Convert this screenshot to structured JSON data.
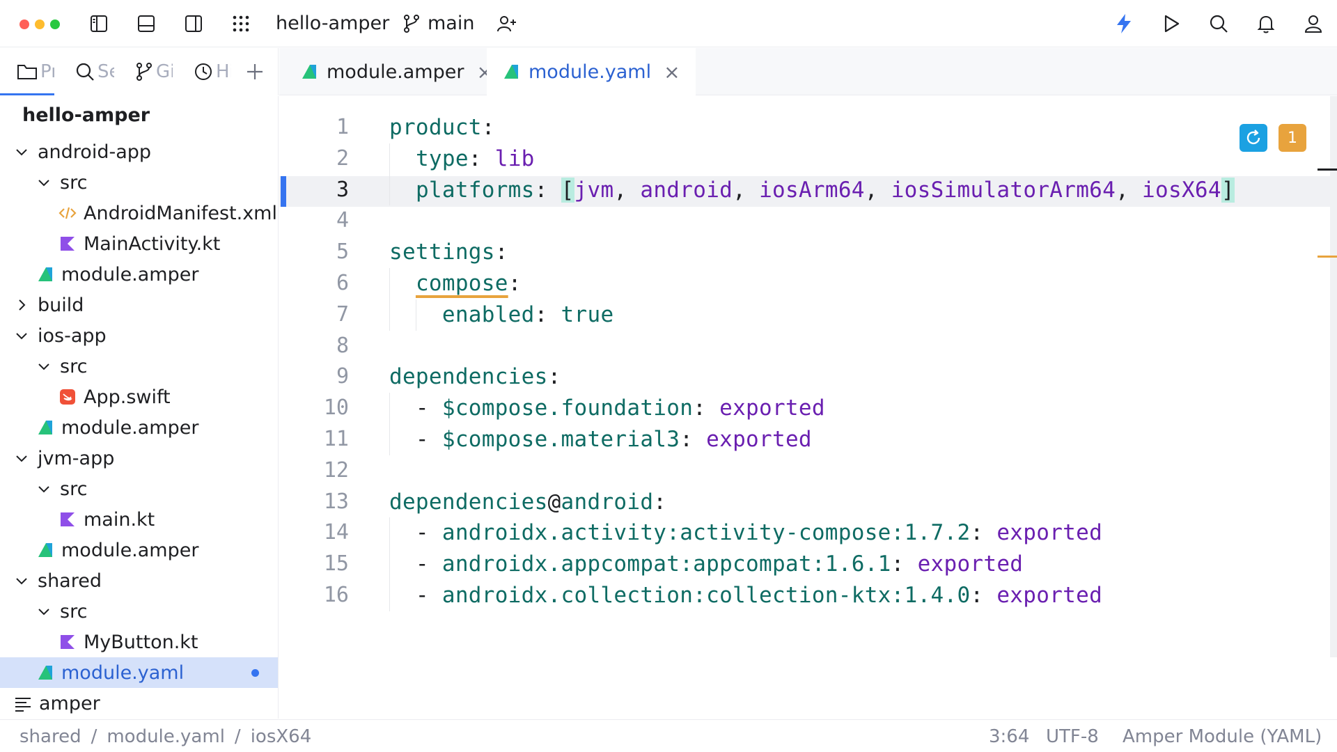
{
  "titlebar": {
    "project_name": "hello-amper",
    "branch": "main",
    "traffic_colors": [
      "#ff5f57",
      "#febc2e",
      "#28c840"
    ]
  },
  "tool_windows": [
    {
      "label": "Project",
      "icon": "folder-icon"
    },
    {
      "label": "Search",
      "icon": "search-icon"
    },
    {
      "label": "Git",
      "icon": "git-branch-icon"
    },
    {
      "label": "History",
      "icon": "clock-icon"
    }
  ],
  "tabs": [
    {
      "label": "module.amper",
      "active": false
    },
    {
      "label": "module.yaml",
      "active": true
    }
  ],
  "tree": {
    "root": "hello-amper",
    "items": [
      {
        "label": "android-app",
        "depth": 0,
        "type": "folder",
        "open": true
      },
      {
        "label": "src",
        "depth": 1,
        "type": "folder",
        "open": true
      },
      {
        "label": "AndroidManifest.xml",
        "depth": 2,
        "type": "xml"
      },
      {
        "label": "MainActivity.kt",
        "depth": 2,
        "type": "kotlin"
      },
      {
        "label": "module.amper",
        "depth": 1,
        "type": "amper"
      },
      {
        "label": "build",
        "depth": 0,
        "type": "folder",
        "open": false
      },
      {
        "label": "ios-app",
        "depth": 0,
        "type": "folder",
        "open": true
      },
      {
        "label": "src",
        "depth": 1,
        "type": "folder",
        "open": true
      },
      {
        "label": "App.swift",
        "depth": 2,
        "type": "swift"
      },
      {
        "label": "module.amper",
        "depth": 1,
        "type": "amper"
      },
      {
        "label": "jvm-app",
        "depth": 0,
        "type": "folder",
        "open": true
      },
      {
        "label": "src",
        "depth": 1,
        "type": "folder",
        "open": true
      },
      {
        "label": "main.kt",
        "depth": 2,
        "type": "kotlin"
      },
      {
        "label": "module.amper",
        "depth": 1,
        "type": "amper"
      },
      {
        "label": "shared",
        "depth": 0,
        "type": "folder",
        "open": true
      },
      {
        "label": "src",
        "depth": 1,
        "type": "folder",
        "open": true
      },
      {
        "label": "MyButton.kt",
        "depth": 2,
        "type": "kotlin"
      },
      {
        "label": "module.yaml",
        "depth": 1,
        "type": "amper",
        "selected": true,
        "modified": true
      },
      {
        "label": "amper",
        "depth": 0,
        "type": "text"
      }
    ]
  },
  "editor": {
    "current_line": 3,
    "lines": [
      [
        {
          "t": "product",
          "c": "k"
        },
        {
          "t": ":",
          "c": "p"
        }
      ],
      [
        {
          "t": "  "
        },
        {
          "t": "type",
          "c": "k"
        },
        {
          "t": ": ",
          "c": "p"
        },
        {
          "t": "lib",
          "c": "v"
        }
      ],
      [
        {
          "t": "  "
        },
        {
          "t": "platforms",
          "c": "k"
        },
        {
          "t": ": ",
          "c": "p"
        },
        {
          "t": "[",
          "c": "p br"
        },
        {
          "t": "jvm",
          "c": "v"
        },
        {
          "t": ", ",
          "c": "p"
        },
        {
          "t": "android",
          "c": "v"
        },
        {
          "t": ", ",
          "c": "p"
        },
        {
          "t": "iosArm64",
          "c": "v"
        },
        {
          "t": ", ",
          "c": "p"
        },
        {
          "t": "iosSimulatorArm64",
          "c": "v"
        },
        {
          "t": ", ",
          "c": "p"
        },
        {
          "t": "iosX64",
          "c": "v"
        },
        {
          "t": "]",
          "c": "p br"
        }
      ],
      [],
      [
        {
          "t": "settings",
          "c": "k"
        },
        {
          "t": ":",
          "c": "p"
        }
      ],
      [
        {
          "t": "  "
        },
        {
          "t": "compose",
          "c": "k warn-ul"
        },
        {
          "t": ":",
          "c": "p"
        }
      ],
      [
        {
          "t": "    "
        },
        {
          "t": "enabled",
          "c": "k"
        },
        {
          "t": ": ",
          "c": "p"
        },
        {
          "t": "true",
          "c": "k"
        }
      ],
      [],
      [
        {
          "t": "dependencies",
          "c": "k"
        },
        {
          "t": ":",
          "c": "p"
        }
      ],
      [
        {
          "t": "  - ",
          "c": "p"
        },
        {
          "t": "$compose.foundation",
          "c": "k"
        },
        {
          "t": ": ",
          "c": "p"
        },
        {
          "t": "exported",
          "c": "v"
        }
      ],
      [
        {
          "t": "  - ",
          "c": "p"
        },
        {
          "t": "$compose.material3",
          "c": "k"
        },
        {
          "t": ": ",
          "c": "p"
        },
        {
          "t": "exported",
          "c": "v"
        }
      ],
      [],
      [
        {
          "t": "dependencies",
          "c": "k"
        },
        {
          "t": "@",
          "c": "p"
        },
        {
          "t": "android",
          "c": "k"
        },
        {
          "t": ":",
          "c": "p"
        }
      ],
      [
        {
          "t": "  - ",
          "c": "p"
        },
        {
          "t": "androidx.activity:activity-compose:1.7.2",
          "c": "k"
        },
        {
          "t": ": ",
          "c": "p"
        },
        {
          "t": "exported",
          "c": "v"
        }
      ],
      [
        {
          "t": "  - ",
          "c": "p"
        },
        {
          "t": "androidx.appcompat:appcompat:1.6.1",
          "c": "k"
        },
        {
          "t": ": ",
          "c": "p"
        },
        {
          "t": "exported",
          "c": "v"
        }
      ],
      [
        {
          "t": "  - ",
          "c": "p"
        },
        {
          "t": "androidx.collection:collection-ktx:1.4.0",
          "c": "k"
        },
        {
          "t": ": ",
          "c": "p"
        },
        {
          "t": "exported",
          "c": "v"
        }
      ]
    ],
    "inspection_warning_count": "1"
  },
  "statusbar": {
    "breadcrumbs": [
      "shared",
      "module.yaml",
      "iosX64"
    ],
    "separator": "/",
    "position": "3:64",
    "encoding": "UTF-8",
    "file_type": "Amper Module (YAML)"
  },
  "colors": {
    "accent": "#3574f0",
    "yaml_key": "#0e6b63",
    "yaml_value": "#6a1fb0",
    "warning": "#e8a33d",
    "reload": "#1ba1e2"
  }
}
